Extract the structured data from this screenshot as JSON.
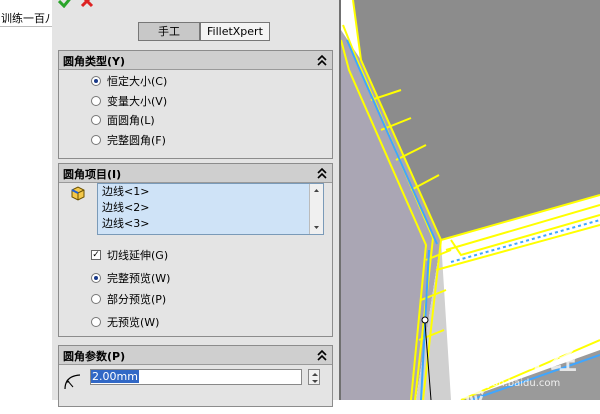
{
  "tree": {
    "partial_text": "训练一百八"
  },
  "property_manager": {
    "tabs": [
      "手工",
      "FilletXpert"
    ],
    "fillet_type": {
      "title": "圆角类型(Y)",
      "options": [
        "恒定大小(C)",
        "变量大小(V)",
        "面圆角(L)",
        "完整圆角(F)"
      ],
      "selected_index": 0
    },
    "fillet_items": {
      "title": "圆角项目(I)",
      "edges": [
        "边线<1>",
        "边线<2>",
        "边线<3>"
      ],
      "tangent_propagation": {
        "label": "切线延伸(G)",
        "checked": true
      },
      "preview_options": [
        "完整预览(W)",
        "部分预览(P)",
        "无预览(W)"
      ],
      "preview_selected_index": 0
    },
    "fillet_params": {
      "title": "圆角参数(P)",
      "radius": "2.00mm"
    }
  },
  "watermark": {
    "main": "Baidu 经验",
    "sub": "jingyan.baidu.com"
  },
  "colors": {
    "selection_yellow": "#ffff00",
    "edge_blue": "#3fa6ff",
    "panel_bg": "#e4e4e4",
    "group_header": "#cfcfcf"
  },
  "icons": [
    "ok-icon",
    "cancel-icon",
    "collapse-icon",
    "edge-cube-icon",
    "radius-icon"
  ]
}
